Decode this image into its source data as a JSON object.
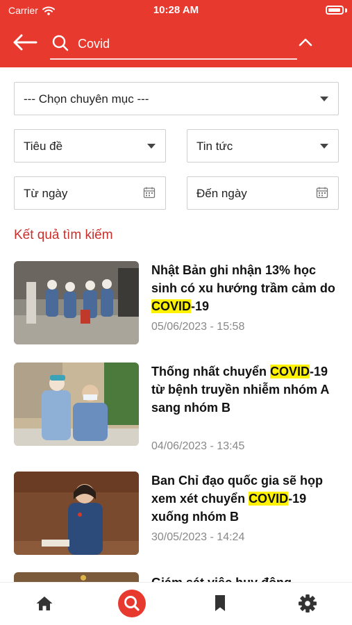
{
  "status_bar": {
    "carrier": "Carrier",
    "time": "10:28 AM"
  },
  "search": {
    "query": "Covid"
  },
  "filters": {
    "category": "--- Chọn chuyên mục ---",
    "field": "Tiêu đề",
    "type": "Tin tức",
    "from_date": "Từ ngày",
    "to_date": "Đến ngày"
  },
  "results_label": "Kết quả tìm kiếm",
  "highlight": "COVID",
  "articles": [
    {
      "pre": "Nhật Bản ghi nhận 13% học sinh có xu hướng trầm cảm do ",
      "post": "-19",
      "date": "05/06/2023 - 15:58"
    },
    {
      "pre": "Thống nhất chuyển ",
      "post": "-19 từ bệnh truyền nhiễm nhóm A sang nhóm B",
      "date": "04/06/2023 - 13:45"
    },
    {
      "pre": "Ban Chỉ đạo quốc gia sẽ họp xem xét chuyển ",
      "post": "-19 xuống nhóm B",
      "date": "30/05/2023 - 14:24"
    },
    {
      "pre": "Giám sát việc huy động",
      "post": "",
      "date": ""
    }
  ],
  "nav": [
    "home-icon",
    "search-icon",
    "bookmark-icon",
    "gear-icon"
  ],
  "colors": {
    "accent": "#e8392f",
    "highlight": "#fff200",
    "results_label": "#c9302c"
  }
}
